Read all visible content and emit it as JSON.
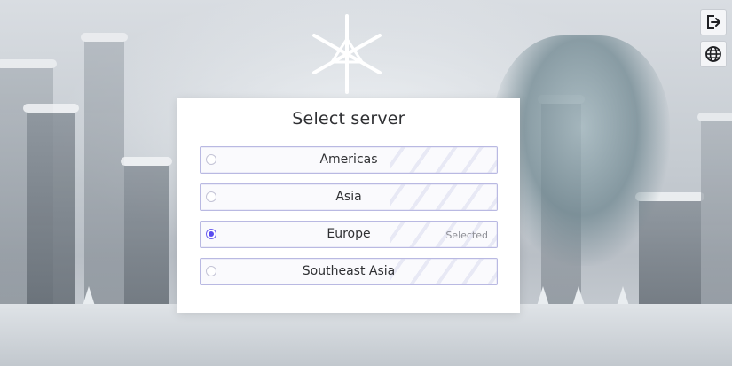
{
  "toolbar": {
    "logout_icon": "logout-icon",
    "language_icon": "globe-icon"
  },
  "dialog": {
    "title": "Select server",
    "accent_color": "#5a4cf0",
    "options": [
      {
        "label": "Americas",
        "selected": false,
        "status": ""
      },
      {
        "label": "Asia",
        "selected": false,
        "status": ""
      },
      {
        "label": "Europe",
        "selected": true,
        "status": "Selected"
      },
      {
        "label": "Southeast Asia",
        "selected": false,
        "status": ""
      }
    ]
  }
}
